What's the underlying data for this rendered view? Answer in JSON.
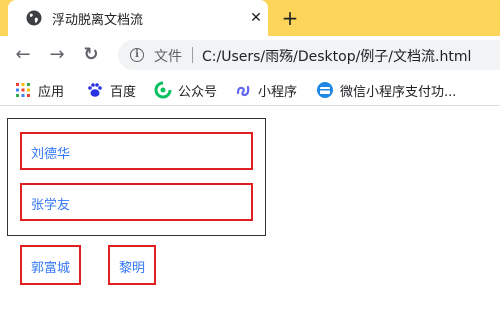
{
  "browser": {
    "tab_title": "浮动脱离文档流",
    "tab_close": "✕",
    "new_tab": "+",
    "back": "←",
    "forward": "→",
    "reload": "↻",
    "file_label": "文件",
    "url": "C:/Users/雨殇/Desktop/例子/文档流.html",
    "tabstrip_color": "#fcd45a"
  },
  "bookmarks": [
    {
      "label": "应用",
      "icon": "apps-grid-icon"
    },
    {
      "label": "百度",
      "icon": "baidu-paw-icon"
    },
    {
      "label": "公众号",
      "icon": "wechat-official-icon"
    },
    {
      "label": "小程序",
      "icon": "mini-program-icon"
    },
    {
      "label": "微信小程序支付功...",
      "icon": "wechat-pay-icon"
    }
  ],
  "page": {
    "items_in_container": [
      "刘德华",
      "张学友"
    ],
    "floating_items": [
      "郭富城",
      "黎明"
    ],
    "box_border_color": "#e02020",
    "text_color": "#3478f6"
  }
}
